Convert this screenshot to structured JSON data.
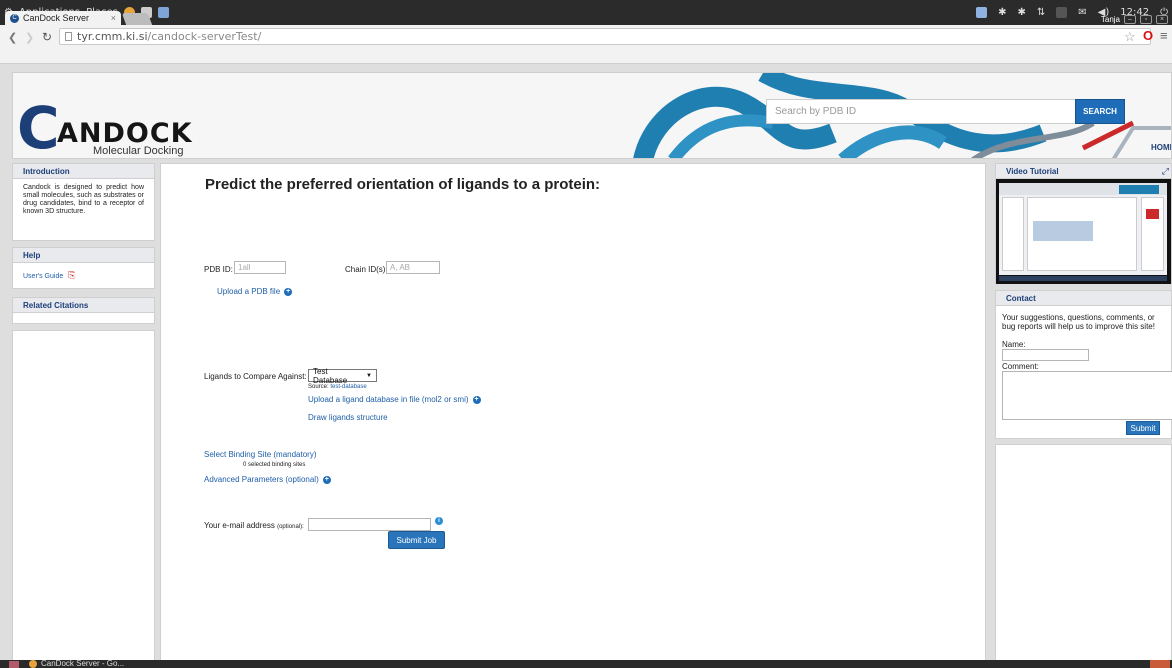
{
  "gnome": {
    "applications": "Applications",
    "places": "Places",
    "clock": "12:42",
    "user": "Tanja"
  },
  "browser": {
    "tab_title": "CanDock Server",
    "tab_close": "×",
    "url_host": "tyr.cmm.ki.si",
    "url_path": "/candock-serverTest/"
  },
  "banner": {
    "logo_c": "C",
    "logo_word": "ANDOCK",
    "logo_subtitle": "Molecular Docking",
    "search_placeholder": "Search by PDB ID",
    "search_button": "SEARCH",
    "home": "HOME"
  },
  "left": {
    "intro_title": "Introduction",
    "intro_text": "Candock is designed to predict how small molecules, such as substrates or drug candidates, bind to a receptor of known 3D structure.",
    "help_title": "Help",
    "users_guide": "User's Guide",
    "citations_title": "Related Citations"
  },
  "main": {
    "title": "Predict the preferred orientation of ligands to a protein:",
    "pdb_label": "PDB ID:",
    "pdb_placeholder": "1all",
    "chain_label": "Chain ID(s):",
    "chain_placeholder": "A, AB",
    "upload_pdb": "Upload a PDB file",
    "ligands_label": "Ligands to Compare Against:",
    "ligands_selected": "Test Database",
    "source_label": "Source:",
    "source_link": "test-database",
    "upload_ligand": "Upload a ligand database in file (mol2 or smi)",
    "draw_ligands": "Draw ligands structure",
    "binding_site": "Select Binding Site (mandatory)",
    "binding_count": "0 selected binding sites",
    "advanced": "Advanced Parameters (optional)",
    "email_label": "Your e-mail address",
    "email_optional": "(optional):",
    "submit": "Submit Job"
  },
  "right": {
    "video_title": "Video Tutorial",
    "contact_title": "Contact",
    "contact_text": "Your suggestions, questions, comments, or bug reports will help us to improve this site!",
    "name_label": "Name:",
    "comment_label": "Comment:",
    "submit": "Submit"
  },
  "taskbar": {
    "item": "CanDock Server - Go..."
  },
  "colors": {
    "brand": "#1d3f78",
    "accent": "#2a74bb",
    "protein": "#1f7fb0"
  }
}
